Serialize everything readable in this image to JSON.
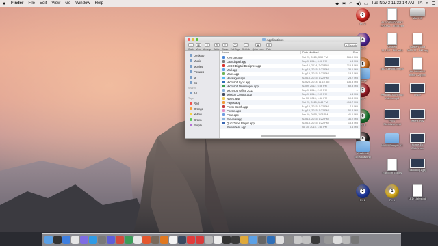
{
  "menubar": {
    "app": "Finder",
    "items": [
      "File",
      "Edit",
      "View",
      "Go",
      "Window",
      "Help"
    ],
    "clock": "Tue Nov 3  11:32:14 AM",
    "user": "TA"
  },
  "finder": {
    "title": "Applications",
    "toolbar": [
      {
        "label": "Back",
        "glyph": "‹ ›"
      },
      {
        "label": "View",
        "glyph": "▦"
      },
      {
        "label": "Arrange",
        "glyph": "≡"
      },
      {
        "label": "Action",
        "glyph": "⚙"
      },
      {
        "label": "Share",
        "glyph": "⇪"
      },
      {
        "label": "Edit Tags",
        "glyph": "◯"
      },
      {
        "label": "Get Info",
        "glyph": "ⓘ"
      },
      {
        "label": "Quick Look",
        "glyph": "◉"
      },
      {
        "label": "Path",
        "glyph": "☰"
      }
    ],
    "search_placeholder": "Search",
    "sidebar": [
      {
        "section": "",
        "items": [
          "Desktop",
          "Music",
          "Movies",
          "Pictures",
          "ta",
          "S5"
        ]
      },
      {
        "section": "Shared",
        "items": [
          "All..."
        ]
      },
      {
        "section": "Tags",
        "items": [
          "Red",
          "Orange",
          "Yellow",
          "Green",
          "Purple"
        ]
      }
    ],
    "tag_colors": [
      "#f2534e",
      "#f7a13b",
      "#f5d341",
      "#5ec75a",
      "#b36fd6"
    ],
    "columns": {
      "name": "Name",
      "date": "Date Modified",
      "size": "Size"
    },
    "rows": [
      {
        "name": "Keynote.app",
        "date": "Oct 23, 2015, 3:50 PM",
        "size": "566.9 MB",
        "color": "#4a86d6"
      },
      {
        "name": "Launchpad.app",
        "date": "Sep 9, 2014, 6:06 PM",
        "size": "1.3 MB",
        "color": "#7a7a7a"
      },
      {
        "name": "LEGO Digital Designer.app",
        "date": "Feb 15, 2014, 3:03 PM",
        "size": "715.8 MB",
        "color": "#d8322f"
      },
      {
        "name": "Mail.app",
        "date": "Aug 15, 2015, 1:22 PM",
        "size": "35.1 MB",
        "color": "#5ca1e6"
      },
      {
        "name": "Maps.app",
        "date": "Aug 15, 2015, 1:22 PM",
        "size": "13.2 MB",
        "color": "#6fb45a"
      },
      {
        "name": "Messages.app",
        "date": "Aug 15, 2015, 1:22 PM",
        "size": "23.7 MB",
        "color": "#59b9f0"
      },
      {
        "name": "Microsoft Lync.app",
        "date": "Aug 25, 2014, 11:10 AM",
        "size": "136.3 MB",
        "color": "#2f6fb8"
      },
      {
        "name": "Microsoft Messenger.app",
        "date": "Aug 9, 2012, 6:36 PM",
        "size": "69.3 MB",
        "color": "#3d9e4e"
      },
      {
        "name": "Microsoft Office 2011",
        "date": "Sep 9, 2014, 2:03 PM",
        "size": "--",
        "color": "#8ab3de"
      },
      {
        "name": "Mission Control.app",
        "date": "Sep 9, 2014, 2:03 PM",
        "size": "1.4 MB",
        "color": "#444b5c"
      },
      {
        "name": "Notes.app",
        "date": "Jul 30, 2015, 1:58 PM",
        "size": "19.3 MB",
        "color": "#f2d15d"
      },
      {
        "name": "Pages.app",
        "date": "Oct 23, 2015, 1:43 PM",
        "size": "418.7 MB",
        "color": "#f29a38"
      },
      {
        "name": "Photo Booth.app",
        "date": "Aug 15, 2015, 1:22 PM",
        "size": "7.6 MB",
        "color": "#c33a3a"
      },
      {
        "name": "Photos.app",
        "date": "Aug 15, 2015, 1:22 PM",
        "size": "50.4 MB",
        "color": "#e58fc2"
      },
      {
        "name": "Pinta.app",
        "date": "Jan 10, 2015, 1:08 PM",
        "size": "41.1 MB",
        "color": "#6e9be0"
      },
      {
        "name": "Preview.app",
        "date": "Aug 15, 2015, 1:22 PM",
        "size": "36.2 MB",
        "color": "#8fb4de"
      },
      {
        "name": "QuickTime Player.app",
        "date": "Aug 15, 2015, 1:22 PM",
        "size": "15.3 MB",
        "color": "#3b67b3"
      },
      {
        "name": "Reminders.app",
        "date": "Jul 30, 2015, 1:58 PM",
        "size": "5.4 MB",
        "color": "#f4f4f4"
      }
    ]
  },
  "desktop_icons": [
    {
      "label": "Pt. 3",
      "kind": "ball",
      "color": "#d9241f",
      "num": "3"
    },
    {
      "label": "ALEO SMOOTHY\nPOD VL...IZER.pdf",
      "kind": "doc"
    },
    {
      "label": "Mac HD",
      "kind": "drive"
    },
    {
      "label": "Pt. 4",
      "kind": "ball",
      "color": "#5a2ca8",
      "num": "4"
    },
    {
      "label": "Untitled\n11.10/1...PM.m4a",
      "kind": "doc"
    },
    {
      "label": "Screen Shot\n2015-11...PM.png",
      "kind": "doc"
    },
    {
      "label": "Pt. 5",
      "kind": "ball",
      "color": "#e07a23",
      "num": "5"
    },
    {
      "label": "pd3 Sketchup.mp4",
      "kind": "video"
    },
    {
      "label": "the historical\nfiction -2.pptx",
      "kind": "doc"
    },
    {
      "label": "Things",
      "kind": "folder"
    },
    {
      "label": "Pt. 7",
      "kind": "ball",
      "color": "#a81d2a",
      "num": "7"
    },
    {
      "label": "Period 6-Sketchup\nVideos.mp4",
      "kind": "video"
    },
    {
      "label": "i.mov",
      "kind": "video"
    },
    {
      "label": "Pt. 6",
      "kind": "ball",
      "color": "#1f8a3a",
      "num": "6"
    },
    {
      "label": "Prd 7\nSketchup.mp4",
      "kind": "video"
    },
    {
      "label": "leftleft.mov",
      "kind": "video"
    },
    {
      "label": "Pt. 8",
      "kind": "ball",
      "color": "#222222",
      "num": "8"
    },
    {
      "label": "Yearbook/\nBroadcasting",
      "kind": "folder"
    },
    {
      "label": "WOW Sample Y1",
      "kind": "folder"
    },
    {
      "label": "Home-Ec\nClub .mov",
      "kind": "video"
    },
    {
      "label": "Random Things",
      "kind": "doc"
    },
    {
      "label": "Backdrop1.jpg",
      "kind": "video"
    },
    {
      "label": "Pt. 1",
      "kind": "ball",
      "color": "#f0c020",
      "num": "1"
    },
    {
      "label": "Pt. 2",
      "kind": "ball",
      "color": "#2340b0",
      "num": "2"
    },
    {
      "label": "LED Lights.pdf",
      "kind": "doc"
    }
  ],
  "dock_colors": [
    "#5aa0e6",
    "#333333",
    "#3e7fe0",
    "#e5e5e5",
    "#7f6ce3",
    "#2f9be6",
    "#7a7a7a",
    "#5d5fda",
    "#d54b3c",
    "#3c9d5a",
    "#e8e8e8",
    "#e4572e",
    "#7a6a5c",
    "#e07820",
    "#f4f4f4",
    "#3a4a60",
    "#e23c3c",
    "#d93b3b",
    "#b7b7b7",
    "#eeeeee",
    "#333",
    "#3a3a3a",
    "#e0a93a",
    "#5ca1e6",
    "#666",
    "#2f6fb8",
    "#e0e0e0",
    "#8e8e8e",
    "#c9c9c9",
    "#c2c2c2",
    "#3a3a3a",
    "#999",
    "#ddd",
    "#bbb",
    "#777"
  ]
}
